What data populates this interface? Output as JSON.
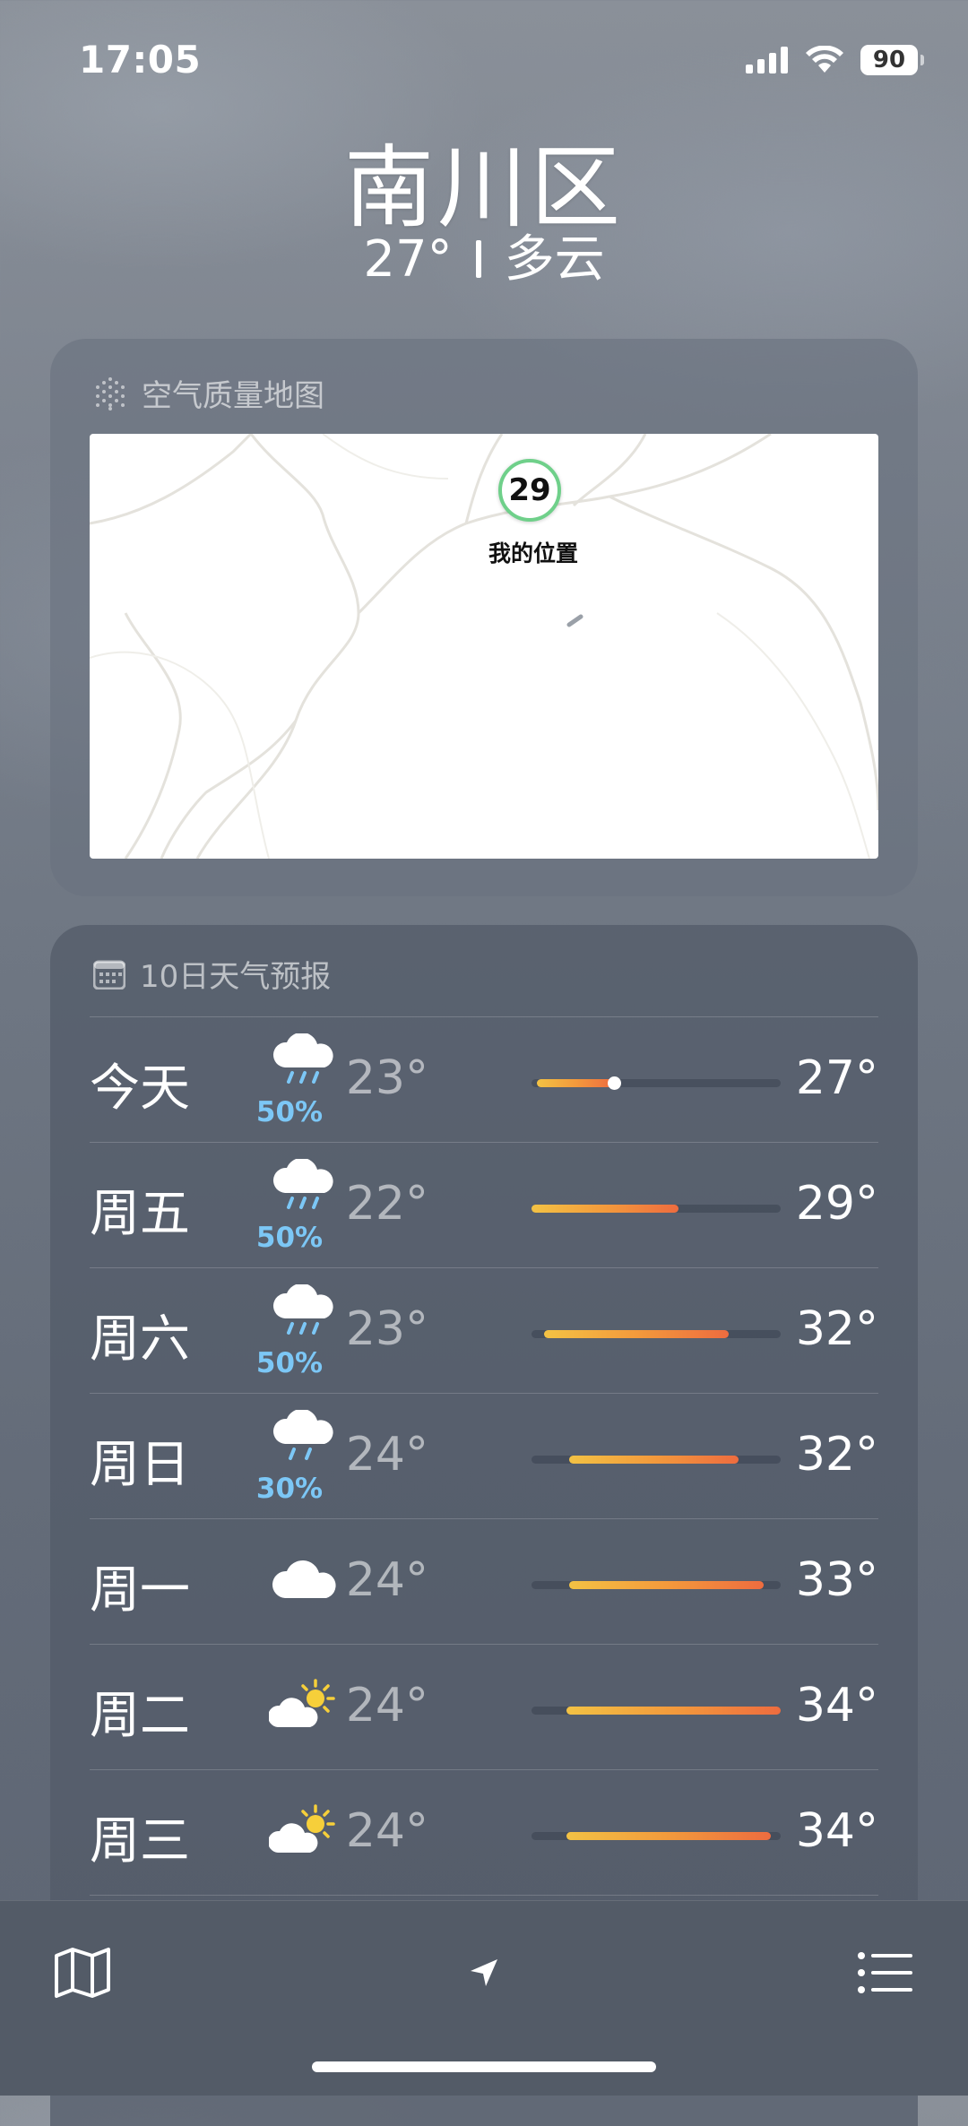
{
  "status": {
    "time": "17:05",
    "battery": "90"
  },
  "header": {
    "city": "南川区",
    "temperature": "27°",
    "condition": "多云"
  },
  "aqi_card": {
    "title": "空气质量地图",
    "aqi_value": "29",
    "location_label": "我的位置"
  },
  "forecast": {
    "title": "10日天气预报",
    "days": [
      {
        "day": "今天",
        "icon": "cloud-rain-icon",
        "precip": "50%",
        "low": "23°",
        "high": "27°",
        "range_start": 0.02,
        "range_end": 0.33,
        "current_marker": 0.33
      },
      {
        "day": "周五",
        "icon": "cloud-rain-icon",
        "precip": "50%",
        "low": "22°",
        "high": "29°",
        "range_start": 0.0,
        "range_end": 0.59
      },
      {
        "day": "周六",
        "icon": "cloud-rain-icon",
        "precip": "50%",
        "low": "23°",
        "high": "32°",
        "range_start": 0.05,
        "range_end": 0.79
      },
      {
        "day": "周日",
        "icon": "cloud-rain-icon",
        "precip": "30%",
        "low": "24°",
        "high": "32°",
        "range_start": 0.15,
        "range_end": 0.83
      },
      {
        "day": "周一",
        "icon": "cloud-icon",
        "precip": "",
        "low": "24°",
        "high": "33°",
        "range_start": 0.15,
        "range_end": 0.93
      },
      {
        "day": "周二",
        "icon": "sun-cloud-icon",
        "precip": "",
        "low": "24°",
        "high": "34°",
        "range_start": 0.14,
        "range_end": 1.0
      },
      {
        "day": "周三",
        "icon": "sun-cloud-icon",
        "precip": "",
        "low": "24°",
        "high": "34°",
        "range_start": 0.14,
        "range_end": 0.96
      }
    ]
  },
  "toolbar": {
    "left": "map-icon",
    "center": "location-arrow-icon",
    "right": "list-icon"
  },
  "colors": {
    "aqi_ring": "#6fd08a",
    "precip": "#7cc7f6",
    "bar_start": "#f3c244",
    "bar_end": "#ee6c3f"
  }
}
